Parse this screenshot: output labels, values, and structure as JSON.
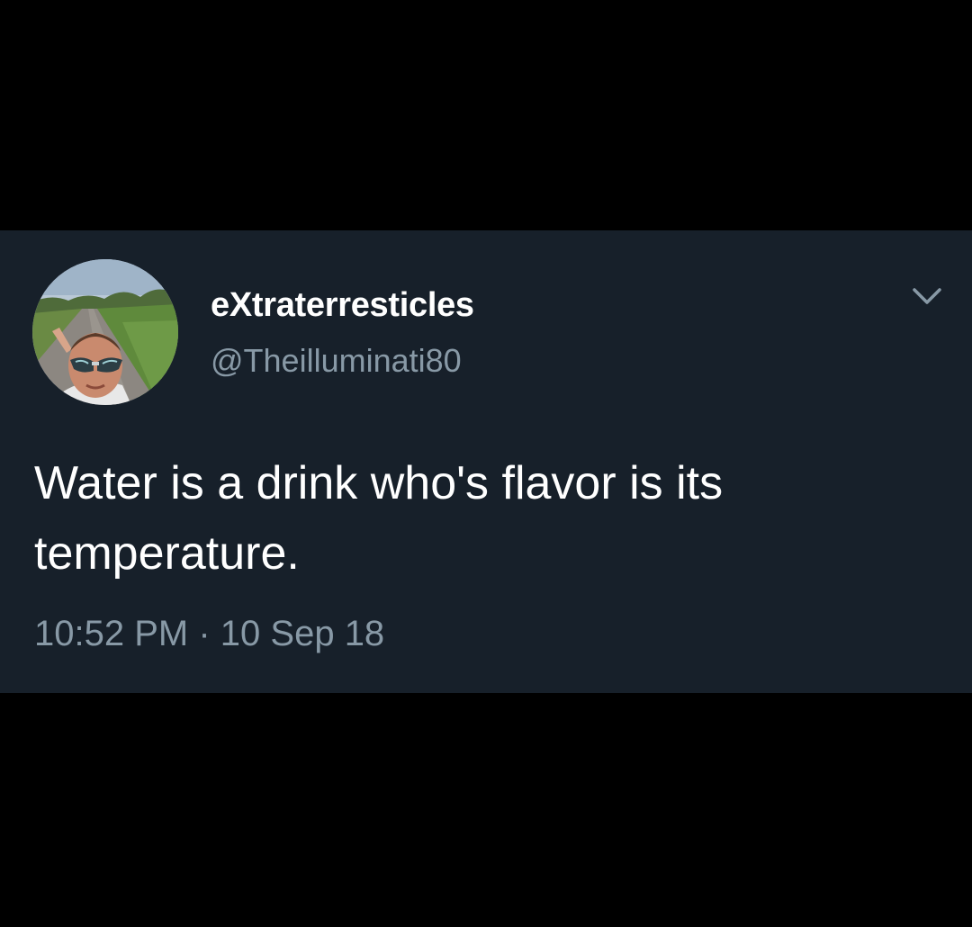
{
  "colors": {
    "page_background": "#000000",
    "card_background": "#17202a",
    "primary_text": "#ffffff",
    "secondary_text": "#8899a6"
  },
  "tweet": {
    "author": {
      "display_name": "eXtraterresticles",
      "handle": "@Theilluminati80",
      "avatar_icon": "profile-photo"
    },
    "menu_icon": "chevron-down-icon",
    "text": "Water is a drink who's flavor is its temperature.",
    "time": "10:52 PM",
    "separator": "·",
    "date": "10 Sep 18"
  }
}
